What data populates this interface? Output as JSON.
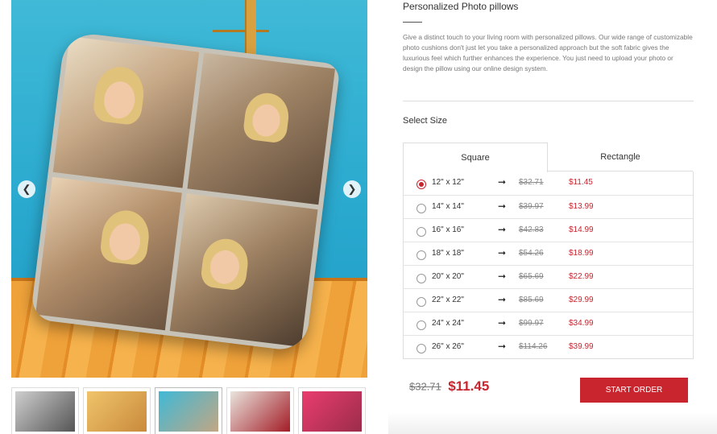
{
  "gallery": {
    "prev_arrow": "❮",
    "next_arrow": "❯",
    "thumbnails": [
      {
        "name": "thumb-1",
        "palette": [
          "#cfcfcf",
          "#555555"
        ]
      },
      {
        "name": "thumb-2",
        "palette": [
          "#f0c46a",
          "#c98a3c"
        ]
      },
      {
        "name": "thumb-3",
        "palette": [
          "#3fb9d6",
          "#c2a684"
        ]
      },
      {
        "name": "thumb-4",
        "palette": [
          "#e9e4dd",
          "#a31c26"
        ]
      },
      {
        "name": "thumb-5",
        "palette": [
          "#ea3d6e",
          "#9b2c4a"
        ]
      }
    ],
    "active_thumbnail": 2
  },
  "product": {
    "title": "Personalized Photo pillows",
    "description": "Give a distinct touch to your living room with personalized pillows. Our wide range of customizable photo cushions don't just let you take a personalized approach but the soft fabric gives the luxurious feel which further enhances the experience. You just need to upload your photo or design the pillow using our online design system."
  },
  "size_selector": {
    "label": "Select Size",
    "tabs": [
      {
        "label": "Square",
        "active": true
      },
      {
        "label": "Rectangle",
        "active": false
      }
    ],
    "arrow_glyph": "➞",
    "options": [
      {
        "size": "12\" x 12\"",
        "old_price": "$32.71",
        "new_price": "$11.45",
        "selected": true
      },
      {
        "size": "14\" x 14\"",
        "old_price": "$39.97",
        "new_price": "$13.99",
        "selected": false
      },
      {
        "size": "16\" x 16\"",
        "old_price": "$42.83",
        "new_price": "$14.99",
        "selected": false
      },
      {
        "size": "18\" x 18\"",
        "old_price": "$54.26",
        "new_price": "$18.99",
        "selected": false
      },
      {
        "size": "20\" x 20\"",
        "old_price": "$65.69",
        "new_price": "$22.99",
        "selected": false
      },
      {
        "size": "22\" x 22\"",
        "old_price": "$85.69",
        "new_price": "$29.99",
        "selected": false
      },
      {
        "size": "24\" x 24\"",
        "old_price": "$99.97",
        "new_price": "$34.99",
        "selected": false
      },
      {
        "size": "26\" x 26\"",
        "old_price": "$114.26",
        "new_price": "$39.99",
        "selected": false
      }
    ]
  },
  "order": {
    "old_price": "$32.71",
    "new_price": "$11.45",
    "start_button": "START ORDER"
  },
  "colors": {
    "accent": "#c9252f",
    "border": "#dddddd",
    "muted_text": "#777777"
  }
}
